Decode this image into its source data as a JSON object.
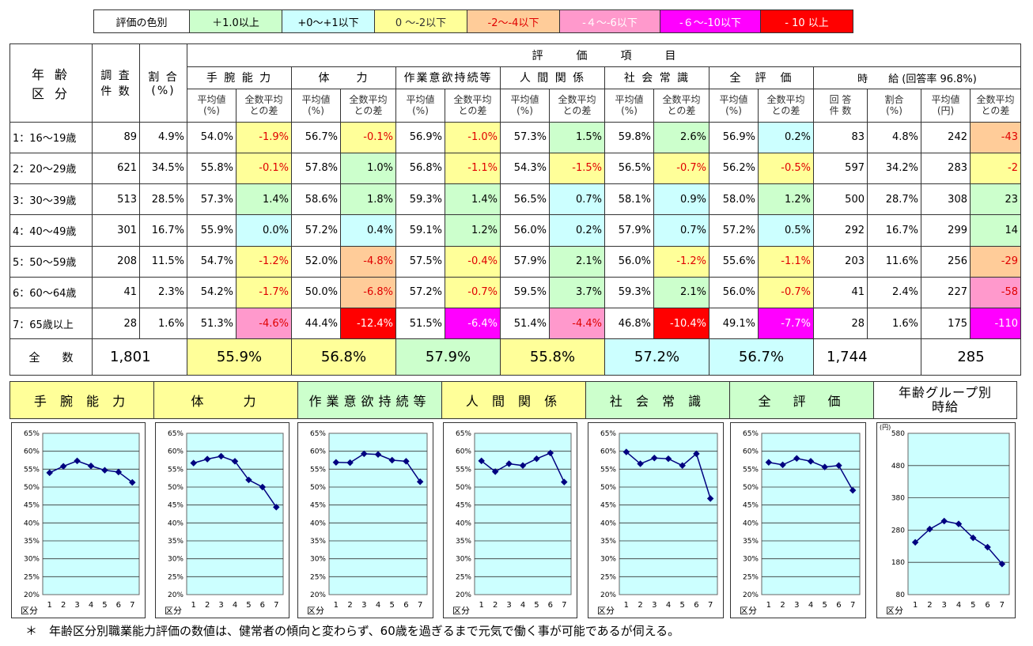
{
  "legend": {
    "header": "評価の色別",
    "items": [
      {
        "label": "＋1.0以上",
        "color": "#ccffcc"
      },
      {
        "label": "+0〜+1以下",
        "color": "#ccffff"
      },
      {
        "label": "0 〜-2以下",
        "color": "#ffff99"
      },
      {
        "label": "-2〜-4以下",
        "color": "#ffcc99"
      },
      {
        "label": "-４〜-6以下",
        "color": "#ff99cc"
      },
      {
        "label": "-６〜-10以下",
        "color": "#ff00ff"
      },
      {
        "label": "- 10 以上",
        "color": "#ff0000"
      }
    ]
  },
  "table": {
    "h_age": "年 齢\n区 分",
    "h_count": "調 査\n件 数",
    "h_ratio": "割 合\n(%)",
    "h_eval": "評　　　価　　　項　　　目",
    "items": [
      "手 腕 能 力",
      "体　　力",
      "作業意欲持続等",
      "人 間 関 係",
      "社 会 常 識",
      "全　評　価"
    ],
    "h_wage": "時　　給 (回答率 96.8%)",
    "sub_avg": "平均値\n(%)",
    "sub_diff": "全数平均\nとの差",
    "sub_wcount": "回 答\n件 数",
    "sub_wratio": "割合\n(%)",
    "sub_wavg": "平均値\n(円)",
    "rows": [
      {
        "age": "1：16〜19歳",
        "count": "89",
        "ratio": "4.9%",
        "vals": [
          [
            "54.0%",
            "-1.9%",
            "y"
          ],
          [
            "56.7%",
            "-0.1%",
            "y"
          ],
          [
            "56.9%",
            "-1.0%",
            "y"
          ],
          [
            "57.3%",
            "1.5%",
            "g"
          ],
          [
            "59.8%",
            "2.6%",
            "g"
          ],
          [
            "56.9%",
            "0.2%",
            "b"
          ]
        ],
        "wcount": "83",
        "wratio": "4.8%",
        "wavg": "242",
        "wdiff": [
          "-43",
          "o"
        ]
      },
      {
        "age": "2：20〜29歳",
        "count": "621",
        "ratio": "34.5%",
        "vals": [
          [
            "55.8%",
            "-0.1%",
            "y"
          ],
          [
            "57.8%",
            "1.0%",
            "g"
          ],
          [
            "56.8%",
            "-1.1%",
            "y"
          ],
          [
            "54.3%",
            "-1.5%",
            "y"
          ],
          [
            "56.5%",
            "-0.7%",
            "y"
          ],
          [
            "56.2%",
            "-0.5%",
            "y"
          ]
        ],
        "wcount": "597",
        "wratio": "34.2%",
        "wavg": "283",
        "wdiff": [
          "-2",
          "y"
        ]
      },
      {
        "age": "3：30〜39歳",
        "count": "513",
        "ratio": "28.5%",
        "vals": [
          [
            "57.3%",
            "1.4%",
            "g"
          ],
          [
            "58.6%",
            "1.8%",
            "g"
          ],
          [
            "59.3%",
            "1.4%",
            "g"
          ],
          [
            "56.5%",
            "0.7%",
            "b"
          ],
          [
            "58.1%",
            "0.9%",
            "b"
          ],
          [
            "58.0%",
            "1.2%",
            "g"
          ]
        ],
        "wcount": "500",
        "wratio": "28.7%",
        "wavg": "308",
        "wdiff": [
          "23",
          "g"
        ]
      },
      {
        "age": "4：40〜49歳",
        "count": "301",
        "ratio": "16.7%",
        "vals": [
          [
            "55.9%",
            "0.0%",
            "b"
          ],
          [
            "57.2%",
            "0.4%",
            "b"
          ],
          [
            "59.1%",
            "1.2%",
            "g"
          ],
          [
            "56.0%",
            "0.2%",
            "b"
          ],
          [
            "57.9%",
            "0.7%",
            "b"
          ],
          [
            "57.2%",
            "0.5%",
            "b"
          ]
        ],
        "wcount": "292",
        "wratio": "16.7%",
        "wavg": "299",
        "wdiff": [
          "14",
          "g"
        ]
      },
      {
        "age": "5：50〜59歳",
        "count": "208",
        "ratio": "11.5%",
        "vals": [
          [
            "54.7%",
            "-1.2%",
            "y"
          ],
          [
            "52.0%",
            "-4.8%",
            "o"
          ],
          [
            "57.5%",
            "-0.4%",
            "y"
          ],
          [
            "57.9%",
            "2.1%",
            "g"
          ],
          [
            "56.0%",
            "-1.2%",
            "y"
          ],
          [
            "55.6%",
            "-1.1%",
            "y"
          ]
        ],
        "wcount": "203",
        "wratio": "11.6%",
        "wavg": "256",
        "wdiff": [
          "-29",
          "o"
        ]
      },
      {
        "age": "6：60〜64歳",
        "count": "41",
        "ratio": "2.3%",
        "vals": [
          [
            "54.2%",
            "-1.7%",
            "y"
          ],
          [
            "50.0%",
            "-6.8%",
            "o"
          ],
          [
            "57.2%",
            "-0.7%",
            "y"
          ],
          [
            "59.5%",
            "3.7%",
            "g"
          ],
          [
            "59.3%",
            "2.1%",
            "g"
          ],
          [
            "56.0%",
            "-0.7%",
            "y"
          ]
        ],
        "wcount": "41",
        "wratio": "2.4%",
        "wavg": "227",
        "wdiff": [
          "-58",
          "p"
        ]
      },
      {
        "age": "7：65歳以上",
        "count": "28",
        "ratio": "1.6%",
        "vals": [
          [
            "51.3%",
            "-4.6%",
            "p"
          ],
          [
            "44.4%",
            "-12.4%",
            "r"
          ],
          [
            "51.5%",
            "-6.4%",
            "m"
          ],
          [
            "51.4%",
            "-4.4%",
            "p"
          ],
          [
            "46.8%",
            "-10.4%",
            "r"
          ],
          [
            "49.1%",
            "-7.7%",
            "m"
          ]
        ],
        "wcount": "28",
        "wratio": "1.6%",
        "wavg": "175",
        "wdiff": [
          "-110",
          "m"
        ]
      }
    ],
    "total": {
      "label": "全　　数",
      "count": "1,801",
      "vals": [
        [
          "55.9%",
          "y"
        ],
        [
          "56.8%",
          "y"
        ],
        [
          "57.9%",
          "g"
        ],
        [
          "55.8%",
          "y"
        ],
        [
          "57.2%",
          "b"
        ],
        [
          "56.7%",
          "b"
        ]
      ],
      "wcount": "1,744",
      "wavg": "285"
    }
  },
  "chart_titles": [
    {
      "label": "手 腕 能 力",
      "color": "#ffff99"
    },
    {
      "label": "体　　力",
      "color": "#ffff99"
    },
    {
      "label": "作業意欲持続等",
      "color": "#ccffcc"
    },
    {
      "label": "人 間 関 係",
      "color": "#ffff99"
    },
    {
      "label": "社 会 常 識",
      "color": "#ccffcc"
    },
    {
      "label": "全　評　価",
      "color": "#ccffcc"
    },
    {
      "label": "年齢グループ別\n時給",
      "color": "#ffffff"
    }
  ],
  "chart_data": [
    {
      "type": "line",
      "name": "手腕能力",
      "x": [
        1,
        2,
        3,
        4,
        5,
        6,
        7
      ],
      "values": [
        54.0,
        55.8,
        57.3,
        55.9,
        54.7,
        54.2,
        51.3
      ],
      "ylim": [
        20,
        65
      ],
      "yticks": [
        "20%",
        "25%",
        "30%",
        "35%",
        "40%",
        "45%",
        "50%",
        "55%",
        "60%",
        "65%"
      ],
      "xlabel": "区分"
    },
    {
      "type": "line",
      "name": "体力",
      "x": [
        1,
        2,
        3,
        4,
        5,
        6,
        7
      ],
      "values": [
        56.7,
        57.8,
        58.6,
        57.2,
        52.0,
        50.0,
        44.4
      ],
      "ylim": [
        20,
        65
      ],
      "yticks": [
        "20%",
        "25%",
        "30%",
        "35%",
        "40%",
        "45%",
        "50%",
        "55%",
        "60%",
        "65%"
      ],
      "xlabel": "区分"
    },
    {
      "type": "line",
      "name": "作業意欲持続等",
      "x": [
        1,
        2,
        3,
        4,
        5,
        6,
        7
      ],
      "values": [
        56.9,
        56.8,
        59.3,
        59.1,
        57.5,
        57.2,
        51.5
      ],
      "ylim": [
        20,
        65
      ],
      "yticks": [
        "20%",
        "25%",
        "30%",
        "35%",
        "40%",
        "45%",
        "50%",
        "55%",
        "60%",
        "65%"
      ],
      "xlabel": "区分"
    },
    {
      "type": "line",
      "name": "人間関係",
      "x": [
        1,
        2,
        3,
        4,
        5,
        6,
        7
      ],
      "values": [
        57.3,
        54.3,
        56.5,
        56.0,
        57.9,
        59.5,
        51.4
      ],
      "ylim": [
        20,
        65
      ],
      "yticks": [
        "20%",
        "25%",
        "30%",
        "35%",
        "40%",
        "45%",
        "50%",
        "55%",
        "60%",
        "65%"
      ],
      "xlabel": "区分"
    },
    {
      "type": "line",
      "name": "社会常識",
      "x": [
        1,
        2,
        3,
        4,
        5,
        6,
        7
      ],
      "values": [
        59.8,
        56.5,
        58.1,
        57.9,
        56.0,
        59.3,
        46.8
      ],
      "ylim": [
        20,
        65
      ],
      "yticks": [
        "20%",
        "25%",
        "30%",
        "35%",
        "40%",
        "45%",
        "50%",
        "55%",
        "60%",
        "65%"
      ],
      "xlabel": "区分"
    },
    {
      "type": "line",
      "name": "全評価",
      "x": [
        1,
        2,
        3,
        4,
        5,
        6,
        7
      ],
      "values": [
        56.9,
        56.2,
        58.0,
        57.2,
        55.6,
        56.0,
        49.1
      ],
      "ylim": [
        20,
        65
      ],
      "yticks": [
        "20%",
        "25%",
        "30%",
        "35%",
        "40%",
        "45%",
        "50%",
        "55%",
        "60%",
        "65%"
      ],
      "xlabel": "区分"
    },
    {
      "type": "line",
      "name": "時給",
      "x": [
        1,
        2,
        3,
        4,
        5,
        6,
        7
      ],
      "values": [
        242,
        283,
        308,
        299,
        256,
        227,
        175
      ],
      "ylim": [
        80,
        580
      ],
      "yticks": [
        "80",
        "180",
        "280",
        "380",
        "480",
        "580"
      ],
      "ylabel": "(円)",
      "xlabel": "区分"
    }
  ],
  "footnote": "＊　年齢区分別職業能力評価の数値は、健常者の傾向と変わらず、60歳を過ぎるまで元気で働く事が可能であるが伺える。"
}
